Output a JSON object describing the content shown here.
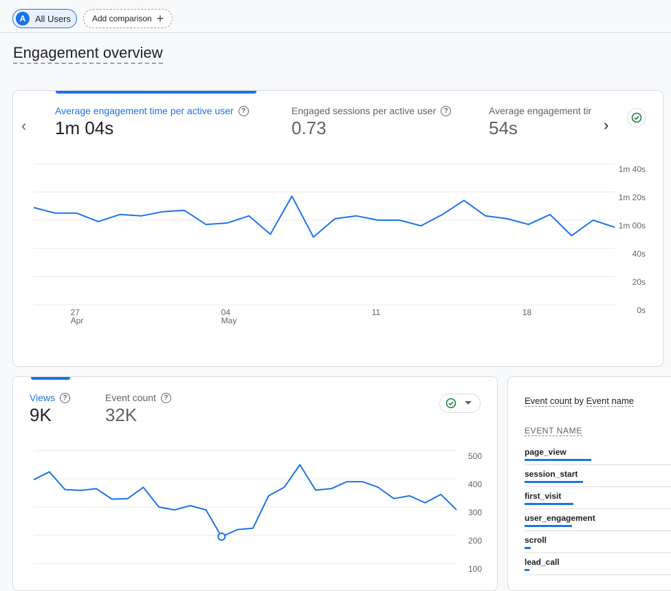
{
  "segment": {
    "avatar": "A",
    "label": "All Users"
  },
  "comparison": {
    "label": "Add comparison",
    "plus": "+"
  },
  "page_title": "Engagement overview",
  "card1": {
    "metrics": [
      {
        "label": "Average engagement time per active user",
        "value": "1m 04s"
      },
      {
        "label": "Engaged sessions per active user",
        "value": "0.73"
      },
      {
        "label": "Average engagement tir",
        "value": "54s"
      }
    ],
    "icons": {
      "prev": "chevron-left-icon",
      "next": "chevron-right-icon",
      "check": "check-circle-icon"
    }
  },
  "card2": {
    "metrics": [
      {
        "label": "Views",
        "value": "9K"
      },
      {
        "label": "Event count",
        "value": "32K"
      }
    ],
    "icons": {
      "check": "check-circle-icon",
      "dropdown": "caret-down-icon"
    }
  },
  "card3": {
    "title_part1": "Event count",
    "title_by": "by",
    "title_part2": "Event name",
    "column_header": "EVENT NAME",
    "rows": [
      {
        "name": "page_view",
        "share": 0.42
      },
      {
        "name": "session_start",
        "share": 0.37
      },
      {
        "name": "first_visit",
        "share": 0.31
      },
      {
        "name": "user_engagement",
        "share": 0.3
      },
      {
        "name": "scroll",
        "share": 0.04
      },
      {
        "name": "lead_call",
        "share": 0.03
      }
    ]
  },
  "colors": {
    "accent": "#1a73e8",
    "check": "#188038",
    "grid": "#e8eaed"
  },
  "chart_data": [
    {
      "type": "line",
      "series": [
        {
          "name": "Average engagement time per active user",
          "values": [
            69,
            65,
            65,
            59,
            64,
            63,
            66,
            67,
            57,
            58,
            63,
            50,
            77,
            48,
            61,
            63,
            60,
            60,
            56,
            64,
            74,
            63,
            61,
            57,
            64,
            49,
            60,
            55
          ]
        }
      ],
      "x_ticks": [
        {
          "index": 2,
          "label": "27",
          "sub": "Apr"
        },
        {
          "index": 9,
          "label": "04",
          "sub": "May"
        },
        {
          "index": 16,
          "label": "11",
          "sub": ""
        },
        {
          "index": 23,
          "label": "18",
          "sub": ""
        }
      ],
      "y_ticks": [
        {
          "value": 100,
          "label": "1m 40s"
        },
        {
          "value": 80,
          "label": "1m 20s"
        },
        {
          "value": 60,
          "label": "1m 00s"
        },
        {
          "value": 40,
          "label": "40s"
        },
        {
          "value": 20,
          "label": "20s"
        },
        {
          "value": 0,
          "label": "0s"
        }
      ],
      "ylim": [
        0,
        100
      ],
      "grid": true
    },
    {
      "type": "line",
      "series": [
        {
          "name": "Views",
          "values": [
            397,
            425,
            362,
            359,
            365,
            328,
            330,
            370,
            300,
            290,
            305,
            290,
            195,
            220,
            225,
            340,
            370,
            450,
            360,
            365,
            390,
            390,
            370,
            330,
            340,
            315,
            345,
            290
          ]
        }
      ],
      "highlight_index": 12,
      "y_ticks": [
        {
          "value": 500,
          "label": "500"
        },
        {
          "value": 400,
          "label": "400"
        },
        {
          "value": 300,
          "label": "300"
        },
        {
          "value": 200,
          "label": "200"
        },
        {
          "value": 100,
          "label": "100"
        }
      ],
      "ylim": [
        0,
        500
      ],
      "grid": true
    }
  ]
}
